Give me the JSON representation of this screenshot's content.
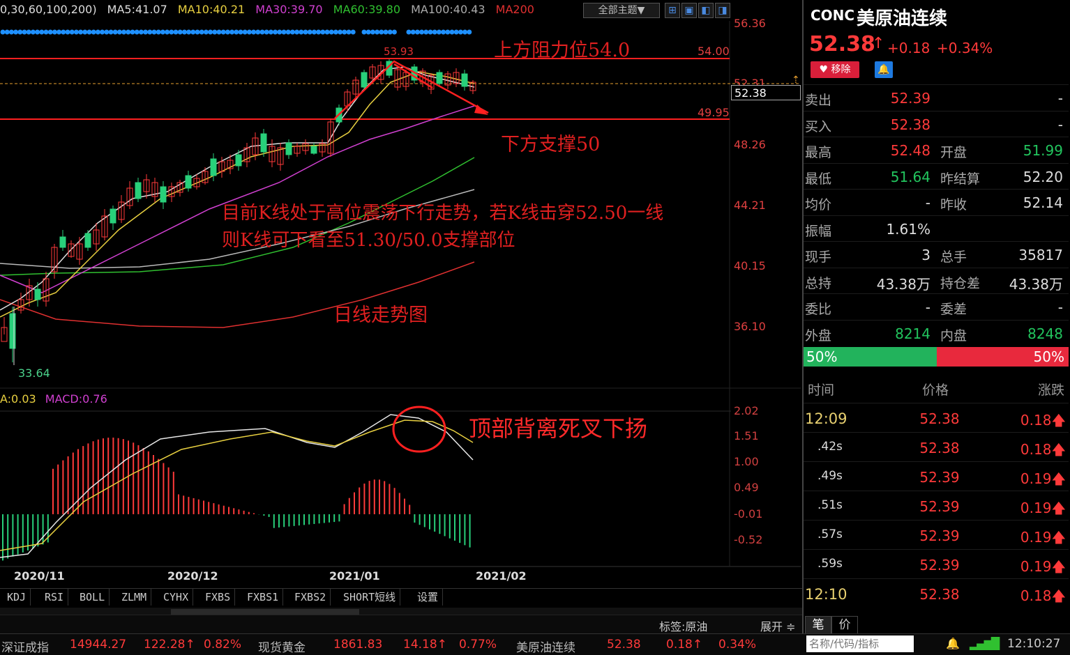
{
  "ma_header": {
    "params": "0,30,60,100,200)",
    "ma5": "MA5:41.07",
    "ma10": "MA10:40.21",
    "ma30": "MA30:39.70",
    "ma60": "MA60:39.80",
    "ma100": "MA100:40.43",
    "ma200": "MA200"
  },
  "toolbar": {
    "theme_label": "全部主题▼"
  },
  "price_axis": [
    "56.36",
    "54.00",
    "52.31",
    "49.95",
    "48.26",
    "44.21",
    "40.15",
    "36.10"
  ],
  "current_price_tag": "52.38",
  "high_marker": "53.93",
  "low_marker": "33.64",
  "annotations": {
    "resistance": "上方阻力位54.0",
    "support": "下方支撑50",
    "analysis_line1": "目前K线处于高位震荡下行走势，若K线击穿52.50一线",
    "analysis_line2": "则K线可下看至51.30/50.0支撑部位",
    "daily_trend": "日线走势图",
    "macd_note": "顶部背离死叉下扬"
  },
  "macd_header": {
    "dea": "A:0.03",
    "macd": "MACD:0.76"
  },
  "macd_axis": [
    "2.02",
    "1.51",
    "1.00",
    "0.49",
    "-0.01",
    "-0.52"
  ],
  "x_axis": [
    "2020/11",
    "2020/12",
    "2021/01",
    "2021/02"
  ],
  "indicator_tabs": [
    "KDJ",
    "RSI",
    "BOLL",
    "ZLMM",
    "CYHX",
    "FXBS",
    "FXBS1",
    "FXBS2",
    "SHORT短线",
    "设置"
  ],
  "label_bar": {
    "tag": "标签:原油",
    "expand": "展开 ≑"
  },
  "quote": {
    "code": "CONC",
    "name": "美原油连续",
    "last": "52.38",
    "change": "+0.18",
    "change_pct": "+0.34%",
    "remove_label": "♥ 移除",
    "rows": [
      {
        "l1": "卖出",
        "v1": "52.39",
        "l2": "",
        "v2": "-"
      },
      {
        "l1": "买入",
        "v1": "52.38",
        "l2": "",
        "v2": "-"
      },
      {
        "l1": "最高",
        "v1": "52.48",
        "l2": "开盘",
        "v2": "51.99"
      },
      {
        "l1": "最低",
        "v1": "51.64",
        "l2": "昨结算",
        "v2": "52.20"
      },
      {
        "l1": "均价",
        "v1": "-",
        "l2": "昨收",
        "v2": "52.14"
      },
      {
        "l1": "振幅",
        "v1": "1.61%",
        "l2": "",
        "v2": ""
      },
      {
        "l1": "现手",
        "v1": "3",
        "l2": "总手",
        "v2": "35817"
      },
      {
        "l1": "总持",
        "v1": "43.38万",
        "l2": "持仓差",
        "v2": "43.38万"
      },
      {
        "l1": "委比",
        "v1": "-",
        "l2": "委差",
        "v2": "-"
      },
      {
        "l1": "外盘",
        "v1": "8214",
        "l2": "内盘",
        "v2": "8248"
      }
    ],
    "ratio_left": "50%",
    "ratio_right": "50%"
  },
  "ticks_header": {
    "time": "时间",
    "price": "价格",
    "change": "涨跌"
  },
  "ticks": [
    {
      "time": "12:09",
      "price": "52.38",
      "chg": "0.18"
    },
    {
      "time": ".42s",
      "price": "52.38",
      "chg": "0.18"
    },
    {
      "time": ".49s",
      "price": "52.39",
      "chg": "0.19"
    },
    {
      "time": ".51s",
      "price": "52.39",
      "chg": "0.19"
    },
    {
      "time": ".57s",
      "price": "52.39",
      "chg": "0.19"
    },
    {
      "time": ".59s",
      "price": "52.39",
      "chg": "0.19"
    },
    {
      "time": "12:10",
      "price": "52.38",
      "chg": "0.18"
    }
  ],
  "rp_tabs": [
    "笔",
    "价"
  ],
  "ticker": [
    {
      "name": "深证成指",
      "v": "14944.27",
      "c": "122.28↑",
      "p": "0.82%"
    },
    {
      "name": "现货黄金",
      "v": "1861.83",
      "c": "14.18↑",
      "p": "0.77%"
    },
    {
      "name": "美原油连续",
      "v": "52.38",
      "c": "0.18↑",
      "p": "0.34%"
    }
  ],
  "search_placeholder": "名称/代码/指标",
  "clock": "12:10:27",
  "colors": {
    "up": "#ff3a3a",
    "down": "#22b35c",
    "accent": "#1e7ae0"
  }
}
